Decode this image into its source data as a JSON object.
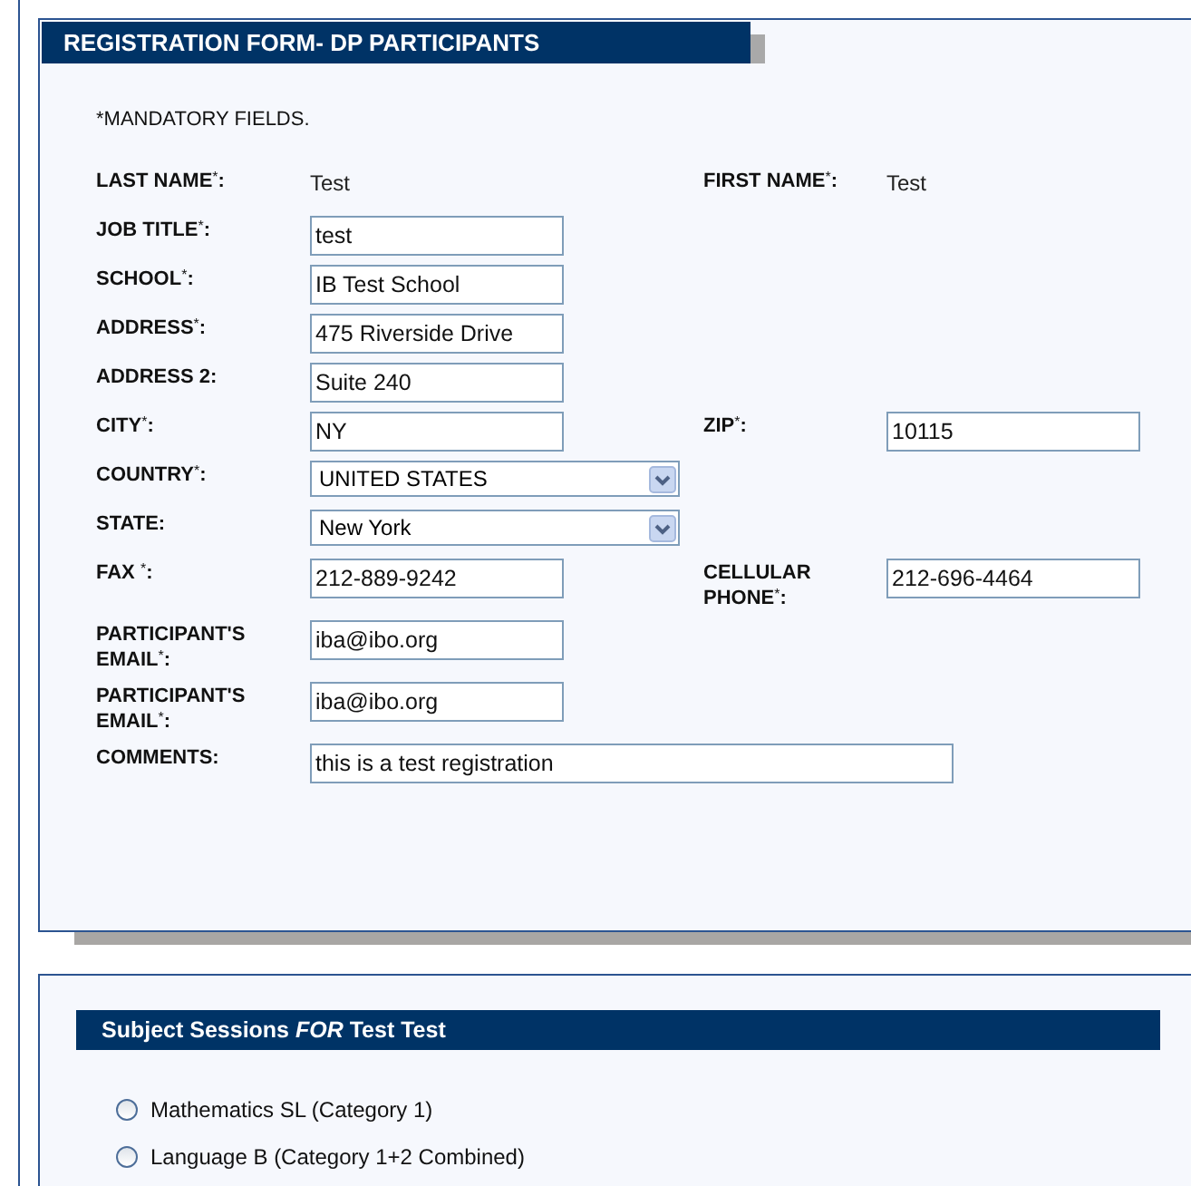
{
  "form": {
    "title": "REGISTRATION FORM- DP PARTICIPANTS",
    "note": "*MANDATORY FIELDS.",
    "rows": [
      {
        "left": {
          "label": "LAST NAME$^{*}$:",
          "kind": "text",
          "value": "Test"
        },
        "right": {
          "label": "FIRST NAME$^{*}$:",
          "kind": "text",
          "value": "Test"
        }
      },
      {
        "left": {
          "label": "JOB TITLE$^{*}$:",
          "kind": "input",
          "value": "test"
        }
      },
      {
        "left": {
          "label": "SCHOOL$^{*}$:",
          "kind": "input",
          "value": "IB Test School"
        }
      },
      {
        "left": {
          "label": "ADDRESS$^{*}$:",
          "kind": "input",
          "value": "475 Riverside Drive"
        }
      },
      {
        "left": {
          "label": "ADDRESS 2:",
          "kind": "input",
          "value": "Suite 240"
        }
      },
      {
        "left": {
          "label": "CITY$^{*}$:",
          "kind": "input",
          "value": "NY"
        },
        "right": {
          "label": "ZIP$^{*}$:",
          "kind": "input",
          "value": "10115"
        }
      },
      {
        "left": {
          "label": "COUNTRY$^{*}$:",
          "kind": "select",
          "value": "UNITED STATES"
        }
      },
      {
        "left": {
          "label": "STATE:",
          "kind": "select",
          "value": "New York"
        }
      },
      {
        "left": {
          "label": "FAX $^{*}$:",
          "kind": "input",
          "value": "212-889-9242"
        },
        "right": {
          "label": "CELLULAR PHONE$^{*}$:",
          "kind": "input",
          "value": "212-696-4464"
        }
      },
      {
        "left": {
          "label": "PARTICIPANT'S EMAIL$^{*}$:",
          "kind": "input",
          "value": "iba@ibo.org"
        }
      },
      {
        "left": {
          "label": "PARTICIPANT'S EMAIL$^{*}$:",
          "kind": "input",
          "value": "iba@ibo.org"
        }
      },
      {
        "left": {
          "label": "COMMENTS:",
          "kind": "wide",
          "value": "this is a test registration"
        }
      }
    ]
  },
  "sessions": {
    "title": "Subject Sessions *FOR* Test Test",
    "options": [
      {
        "label": "Mathematics SL (Category 1)",
        "selected": false
      },
      {
        "label": "Language B (Category 1+2 Combined)",
        "selected": false
      }
    ]
  }
}
